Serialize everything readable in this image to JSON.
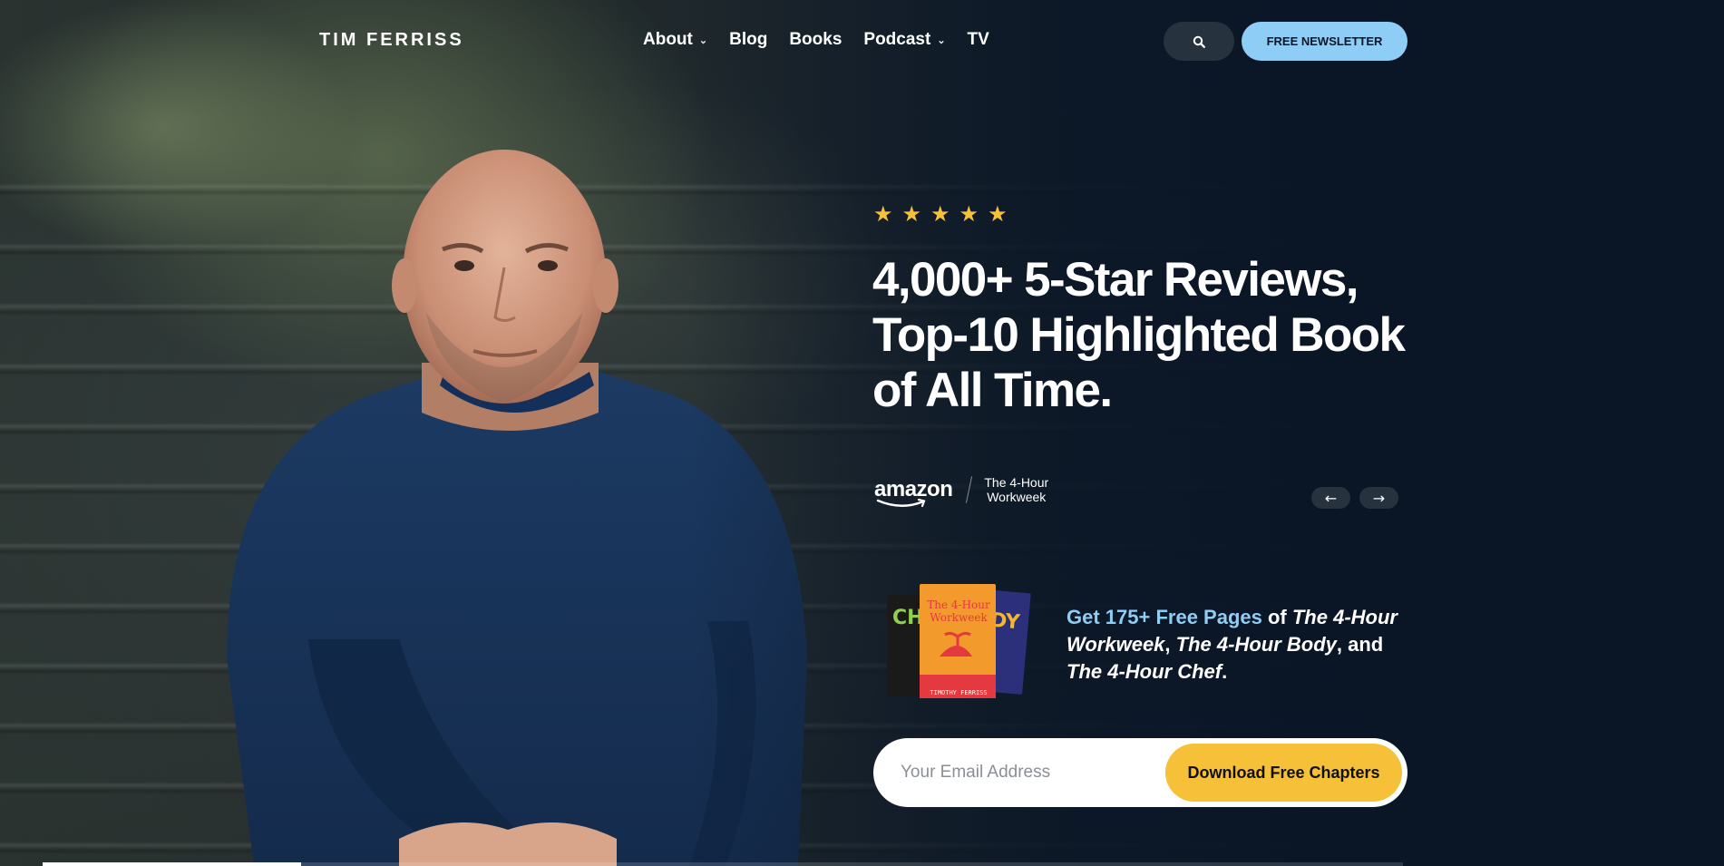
{
  "brand": {
    "logo_text": "TIM FERRISS"
  },
  "nav": {
    "items": [
      {
        "label": "About",
        "has_dropdown": true
      },
      {
        "label": "Blog",
        "has_dropdown": false
      },
      {
        "label": "Books",
        "has_dropdown": false
      },
      {
        "label": "Podcast",
        "has_dropdown": true
      },
      {
        "label": "TV",
        "has_dropdown": false
      }
    ],
    "search_icon": "search-icon",
    "newsletter_label": "FREE NEWSLETTER"
  },
  "hero": {
    "rating_stars": 5,
    "headline_lines": [
      "4,000+ 5-Star Reviews,",
      "Top-10 Highlighted Book",
      "of All Time."
    ],
    "source_logo": "amazon",
    "book_credit_line1": "The 4-Hour",
    "book_credit_line2": "Workweek",
    "prev_icon": "arrow-left-icon",
    "next_icon": "arrow-right-icon"
  },
  "promo": {
    "highlight": "Get 175+ Free Pages",
    "text_of": " of ",
    "book1": "The 4-Hour Workweek",
    "sep1": ", ",
    "book2": "The 4-Hour Body",
    "sep2": ", and ",
    "book3": "The 4-Hour Chef",
    "end": ".",
    "cover_title": "The 4-Hour Workweek",
    "cover_author": "TIMOTHY FERRISS"
  },
  "form": {
    "email_placeholder": "Your Email Address",
    "email_value": "",
    "submit_label": "Download Free Chapters"
  },
  "carousel": {
    "progress": 0.19
  },
  "colors": {
    "accent_blue": "#8ecdf6",
    "accent_yellow": "#f6c138",
    "nav_button_bg": "#26333f"
  }
}
